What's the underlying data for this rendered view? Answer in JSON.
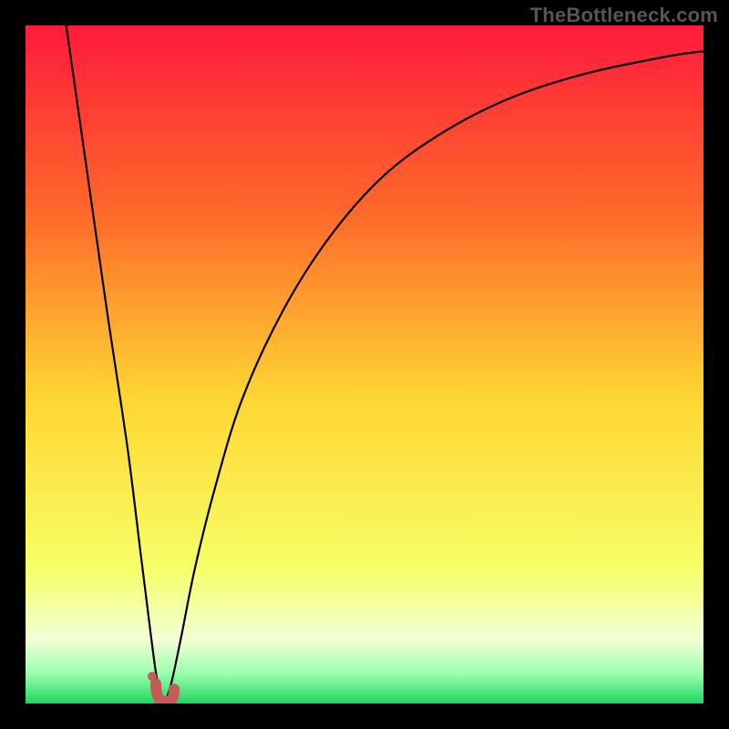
{
  "watermark": "TheBottleneck.com",
  "colors": {
    "top": "#ff1a3c",
    "upper_mid": "#ff6a2a",
    "mid": "#ffd633",
    "lower_mid": "#f6ff66",
    "pale": "#f3ffd6",
    "green": "#1fd65f",
    "curve": "#000000",
    "marker": "#c65a57",
    "frame": "#000000"
  },
  "chart_data": {
    "type": "line",
    "title": "",
    "xlabel": "",
    "ylabel": "",
    "xlim": [
      0,
      100
    ],
    "ylim": [
      0,
      100
    ],
    "series": [
      {
        "name": "bottleneck-curve",
        "x": [
          6,
          9,
          12,
          15,
          17,
          18.5,
          19.5,
          20.5,
          21.5,
          23,
          25,
          28,
          32,
          38,
          45,
          53,
          62,
          72,
          83,
          95,
          100
        ],
        "y": [
          100,
          79,
          58,
          38,
          22,
          10,
          3,
          0.5,
          3,
          10,
          20,
          32,
          45,
          58,
          69,
          78,
          84.5,
          89.5,
          93,
          95.5,
          96.2
        ]
      }
    ],
    "marker": {
      "x": 20.3,
      "y_base": 0.5,
      "shape": "J",
      "color": "#c65a57"
    },
    "gradient_bands": [
      {
        "stop": 0.0,
        "color": "#ff1a3c"
      },
      {
        "stop": 0.28,
        "color": "#ff6a2a"
      },
      {
        "stop": 0.55,
        "color": "#ffd633"
      },
      {
        "stop": 0.8,
        "color": "#f6ff66"
      },
      {
        "stop": 0.905,
        "color": "#f3ffd6"
      },
      {
        "stop": 0.955,
        "color": "#9dffb0"
      },
      {
        "stop": 1.0,
        "color": "#1fd65f"
      }
    ]
  }
}
